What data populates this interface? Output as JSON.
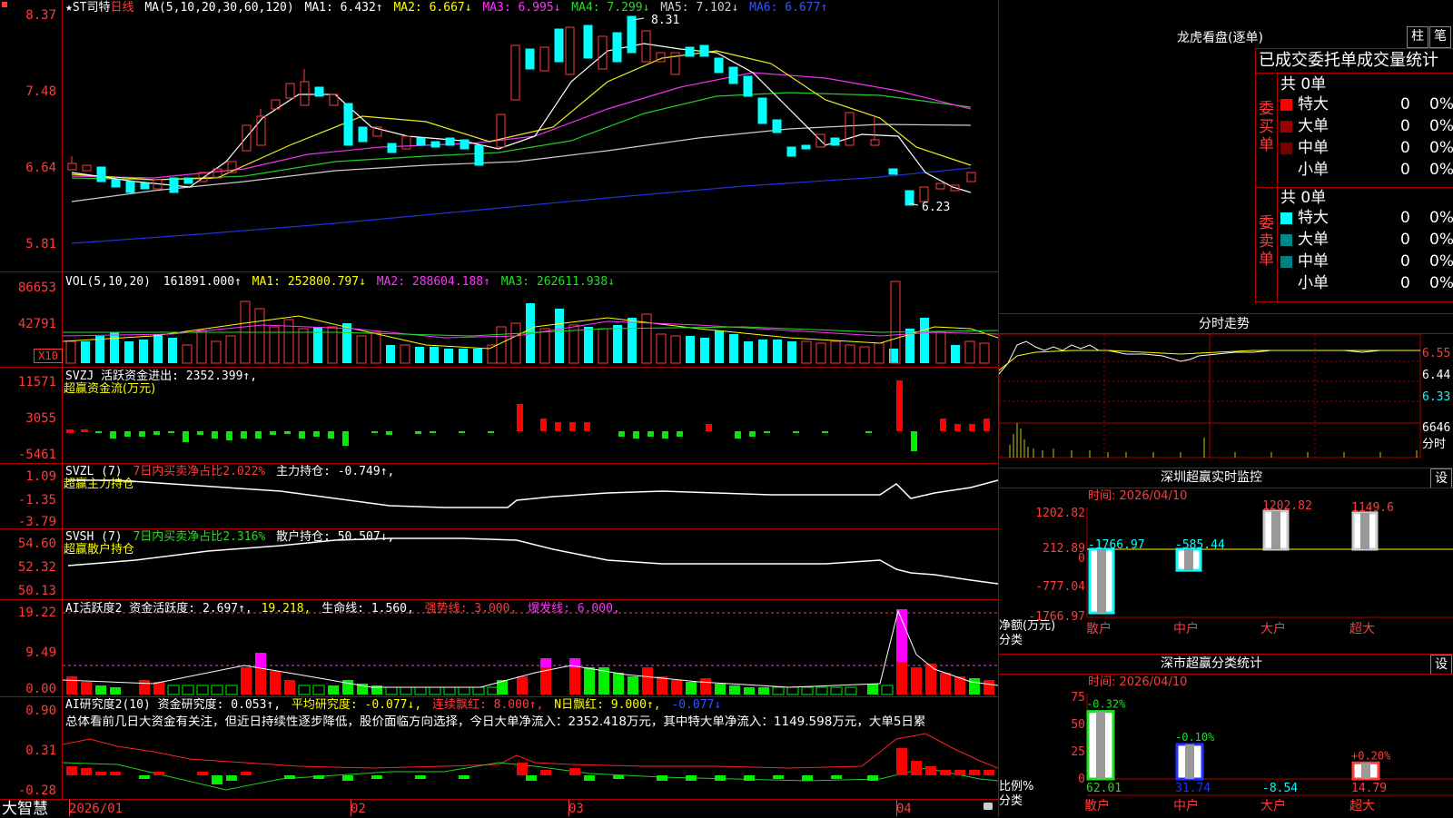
{
  "main_legend": {
    "star": "★",
    "name": "ST司特",
    "period": "日线",
    "ma_spec": "MA(5,10,20,30,60,120)",
    "ma1": "MA1: 6.432↑",
    "ma2": "MA2: 6.667↓",
    "ma3": "MA3: 6.995↓",
    "ma4": "MA4: 7.299↓",
    "ma5": "MA5: 7.102↓",
    "ma6": "MA6: 6.677↑",
    "high_label": "8.31",
    "low_label": "6.23"
  },
  "price_axis": [
    "8.37",
    "7.48",
    "6.64",
    "5.81"
  ],
  "vol": {
    "legend": "VOL(5,10,20)",
    "val": "161891.000↑",
    "ma1": "MA1: 252800.797↓",
    "ma2": "MA2: 288604.188↑",
    "ma3": "MA3: 262611.938↓",
    "axis": [
      "86653",
      "42791"
    ],
    "unit": "X10"
  },
  "svzj": {
    "legend": "SVZJ  活跃资金进出: 2352.399↑,",
    "sub": "超赢资金流(万元)",
    "axis": [
      "11571",
      "3055",
      "-5461"
    ]
  },
  "svzl": {
    "legend_a": "SVZL (7)",
    "legend_b": "7日内买卖净占比2.022%",
    "legend_c": "主力持仓: -0.749↑,",
    "sub": "超赢主力持仓",
    "axis": [
      "1.09",
      "-1.35",
      "-3.79"
    ]
  },
  "svsh": {
    "legend_a": "SVSH (7)",
    "legend_b": "7日内买卖净占比2.316%",
    "legend_c": "散户持仓: 50.507↓,",
    "sub": "超赢散户持仓",
    "axis": [
      "54.60",
      "52.32",
      "50.13"
    ]
  },
  "ai1": {
    "legend_a": "AI活跃度2 资金活跃度: 2.697↑,",
    "legend_b": "19.218,",
    "legend_c": "生命线: 1.560,",
    "legend_d": "强势线: 3.000,",
    "legend_e": "爆发线: 6.000,",
    "axis": [
      "19.22",
      "9.49",
      "0.00"
    ]
  },
  "ai2": {
    "legend_a": "AI研究度2(10) 资金研究度: 0.053↑,",
    "legend_b": "平均研究度: -0.077↓,",
    "legend_c": "连续飘红: 8.000↑,",
    "legend_d": "N日飘红: 9.000↑,",
    "legend_e": "-0.077↓",
    "summary": "总体看前几日大资金有关注，但近日持续性逐步降低，股价面临方向选择，今日大单净流入：2352.418万元，其中特大单净流入：1149.598万元，大单5日累",
    "axis": [
      "0.90",
      "0.31",
      "-0.28"
    ]
  },
  "time_axis": {
    "brand": "大智慧",
    "labels": [
      "2026/01",
      "02",
      "03",
      "04"
    ]
  },
  "dragon": {
    "title": "龙虎看盘(逐单)",
    "btn1": "柱",
    "btn2": "笔",
    "header": "已成交委托单成交量统计",
    "buy_label": "委买单",
    "sell_label": "委卖单",
    "buy_count": "共 0单",
    "sell_count": "共 0单",
    "buy_rows": [
      {
        "name": "特大",
        "qty": "0",
        "pct": "0%",
        "color": "#ff0000"
      },
      {
        "name": "大单",
        "qty": "0",
        "pct": "0%",
        "color": "#990000"
      },
      {
        "name": "中单",
        "qty": "0",
        "pct": "0%",
        "color": "#770000"
      },
      {
        "name": "小单",
        "qty": "0",
        "pct": "0%",
        "color": ""
      }
    ],
    "sell_rows": [
      {
        "name": "特大",
        "qty": "0",
        "pct": "0%",
        "color": "#00ffff"
      },
      {
        "name": "大单",
        "qty": "0",
        "pct": "0%",
        "color": "#008888"
      },
      {
        "name": "中单",
        "qty": "0",
        "pct": "0%",
        "color": "#008080"
      },
      {
        "name": "小单",
        "qty": "0",
        "pct": "0%",
        "color": ""
      }
    ]
  },
  "intraday": {
    "title": "分时走势",
    "axis": [
      "6.55",
      "6.44",
      "6.33"
    ],
    "vol_label": "6646",
    "vol_unit": "分时"
  },
  "sz_monitor": {
    "title": "深圳超赢实时监控",
    "btn": "设",
    "date": "时间: 2026/04/10",
    "axis": [
      "1202.82",
      "212.89",
      "0",
      "-777.04",
      "-1766.97"
    ],
    "ylabel": "净额(万元)",
    "xlabel": "分类",
    "bars": [
      {
        "name": "散户",
        "value": "-1766.97"
      },
      {
        "name": "中户",
        "value": "-585.44"
      },
      {
        "name": "大户",
        "value": "1202.82"
      },
      {
        "name": "超大",
        "value": "1149.6"
      }
    ]
  },
  "sz_classify": {
    "title": "深市超赢分类统计",
    "btn": "设",
    "date": "时间: 2026/04/10",
    "axis": [
      "75",
      "50",
      "25",
      "0"
    ],
    "ylabel": "比例%",
    "xlabel": "分类",
    "bars": [
      {
        "name": "散户",
        "pct": "-0.32%",
        "value": "62.01"
      },
      {
        "name": "中户",
        "pct": "-0.10%",
        "value": "31.74"
      },
      {
        "name": "大户",
        "pct": "",
        "value": "-8.54"
      },
      {
        "name": "超大",
        "pct": "+0.20%",
        "value": "14.79"
      }
    ]
  },
  "chart_data": [
    {
      "type": "bar",
      "title": "深圳超赢实时监控",
      "categories": [
        "散户",
        "中户",
        "大户",
        "超大"
      ],
      "values": [
        -1766.97,
        -585.44,
        1202.82,
        1149.6
      ],
      "ylabel": "净额(万元)",
      "xlabel": "分类",
      "ylim": [
        -1766.97,
        1202.82
      ]
    },
    {
      "type": "bar",
      "title": "深市超赢分类统计",
      "categories": [
        "散户",
        "中户",
        "大户",
        "超大"
      ],
      "values": [
        62.01,
        31.74,
        -8.54,
        14.79
      ],
      "ylabel": "比例%",
      "xlabel": "分类",
      "ylim": [
        0,
        75
      ]
    }
  ]
}
